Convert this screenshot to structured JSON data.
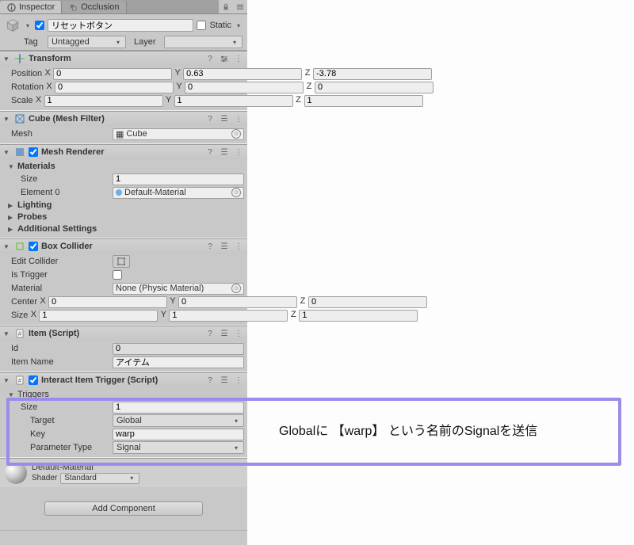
{
  "tabs": {
    "inspector": "Inspector",
    "occlusion": "Occlusion"
  },
  "gameObject": {
    "name": "リセットボタン",
    "staticLabel": "Static",
    "tagLabel": "Tag",
    "tagValue": "Untagged",
    "layerLabel": "Layer",
    "layerValue": ""
  },
  "transform": {
    "title": "Transform",
    "positionLabel": "Position",
    "rotationLabel": "Rotation",
    "scaleLabel": "Scale",
    "position": {
      "x": "0",
      "y": "0.63",
      "z": "-3.78"
    },
    "rotation": {
      "x": "0",
      "y": "0",
      "z": "0"
    },
    "scale": {
      "x": "1",
      "y": "1",
      "z": "1"
    }
  },
  "axis": {
    "x": "X",
    "y": "Y",
    "z": "Z"
  },
  "meshFilter": {
    "title": "Cube (Mesh Filter)",
    "meshLabel": "Mesh",
    "meshValue": "Cube"
  },
  "meshRenderer": {
    "title": "Mesh Renderer",
    "materialsLabel": "Materials",
    "sizeLabel": "Size",
    "sizeValue": "1",
    "element0Label": "Element 0",
    "element0Value": "Default-Material",
    "lighting": "Lighting",
    "probes": "Probes",
    "additional": "Additional Settings"
  },
  "boxCollider": {
    "title": "Box Collider",
    "editColliderLabel": "Edit Collider",
    "isTriggerLabel": "Is Trigger",
    "materialLabel": "Material",
    "materialValue": "None (Physic Material)",
    "centerLabel": "Center",
    "sizeLabel": "Size",
    "center": {
      "x": "0",
      "y": "0",
      "z": "0"
    },
    "size": {
      "x": "1",
      "y": "1",
      "z": "1"
    }
  },
  "itemScript": {
    "title": "Item (Script)",
    "idLabel": "Id",
    "idValue": "0",
    "itemNameLabel": "Item Name",
    "itemNameValue": "アイテム"
  },
  "interactTrigger": {
    "title": "Interact Item Trigger (Script)",
    "triggersLabel": "Triggers",
    "sizeLabel": "Size",
    "sizeValue": "1",
    "targetLabel": "Target",
    "targetValue": "Global",
    "keyLabel": "Key",
    "keyValue": "warp",
    "paramTypeLabel": "Parameter Type",
    "paramTypeValue": "Signal"
  },
  "material": {
    "name": "Default-Material",
    "shaderLabel": "Shader",
    "shaderValue": "Standard"
  },
  "addComponent": "Add Component",
  "annotation": "Globalに 【warp】 という名前のSignalを送信"
}
